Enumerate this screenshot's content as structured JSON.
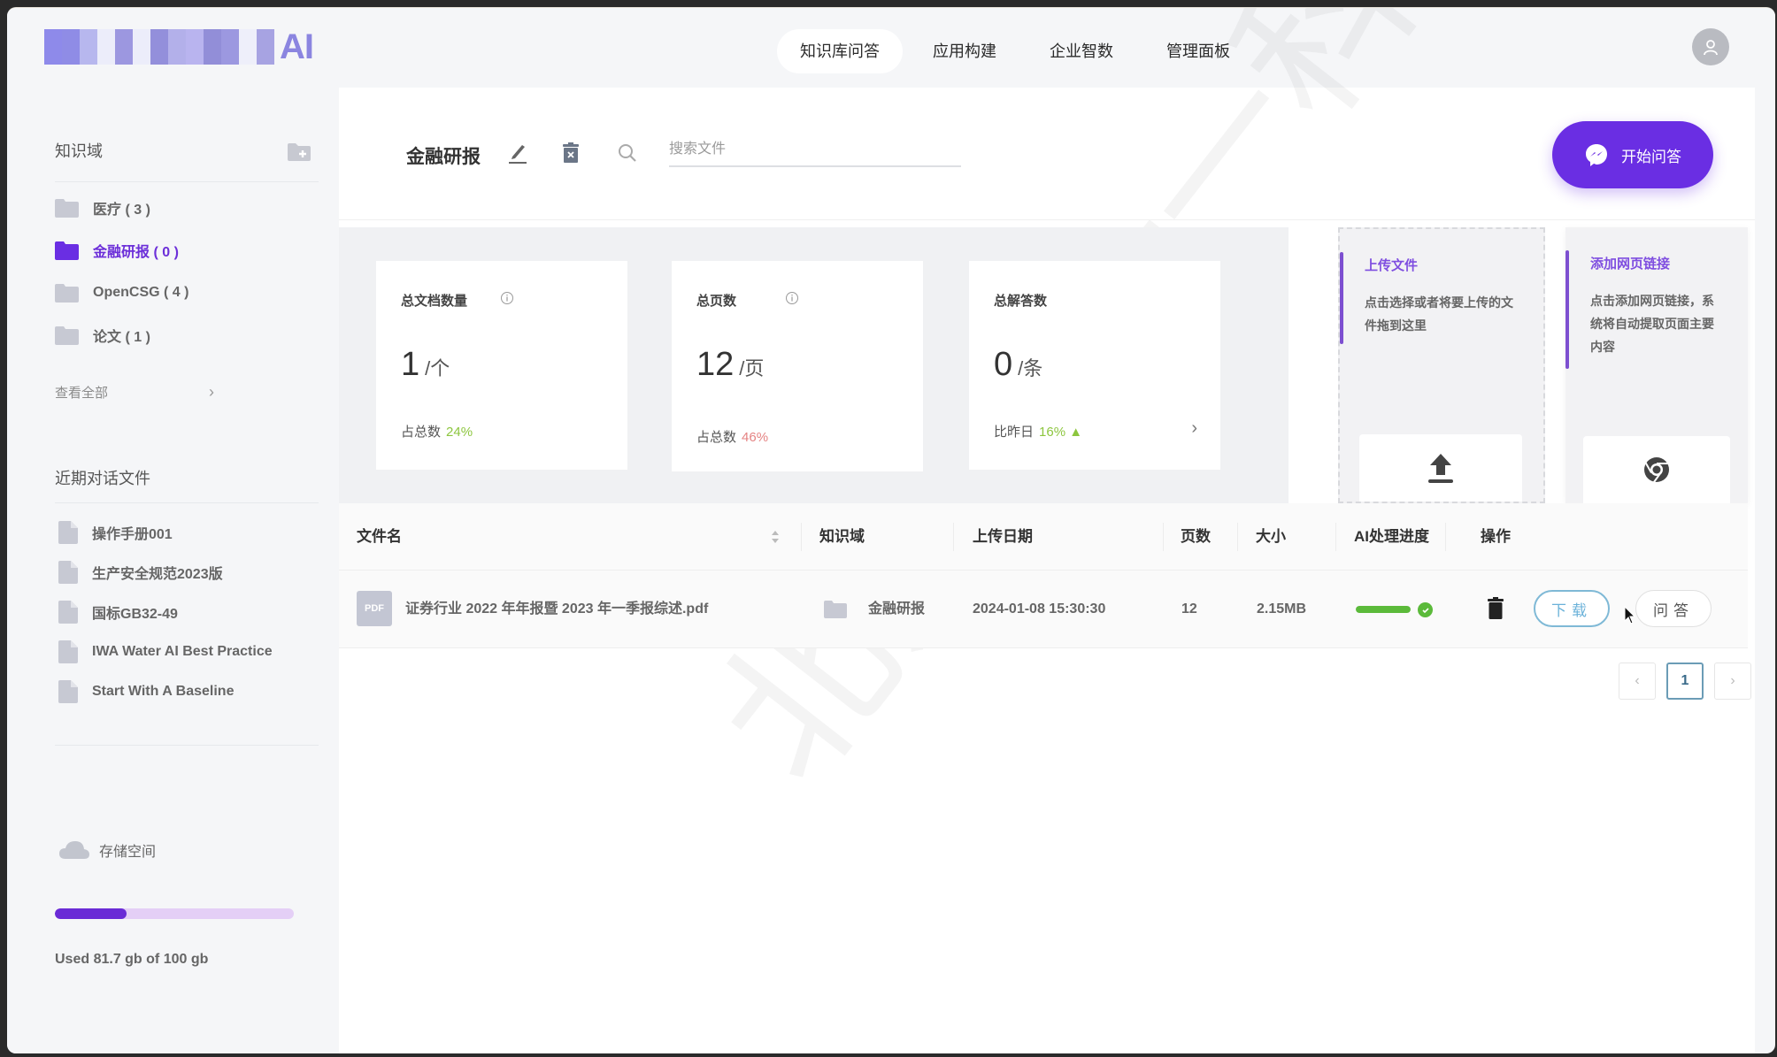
{
  "app": {
    "logo_suffix": "AI",
    "logo_colors": [
      "#8e8aea",
      "#8f8ce6",
      "#b7b7ee",
      "#ecedfa",
      "#9c97e0",
      "#ecedfa",
      "#938fdb",
      "#b3b0ea",
      "#b9b4ef",
      "#928ed8",
      "#9c98e0",
      "#eeeffa",
      "#a7a3e2"
    ]
  },
  "nav": {
    "items": [
      {
        "label": "知识库问答",
        "active": true
      },
      {
        "label": "应用构建",
        "active": false
      },
      {
        "label": "企业智数",
        "active": false
      },
      {
        "label": "管理面板",
        "active": false
      }
    ]
  },
  "sidebar": {
    "knowledge_title": "知识域",
    "folders": [
      {
        "label": "医疗 ( 3 )",
        "active": false
      },
      {
        "label": "金融研报 ( 0 )",
        "active": true
      },
      {
        "label": "OpenCSG ( 4 )",
        "active": false
      },
      {
        "label": "论文 ( 1 )",
        "active": false
      }
    ],
    "view_all": "查看全部",
    "recent_title": "近期对话文件",
    "recent_files": [
      "操作手册001",
      "生产安全规范2023版",
      "国标GB32-49",
      "IWA Water AI Best Practice",
      "Start With A Baseline"
    ],
    "storage": {
      "label": "存储空间",
      "used_fraction": 0.3,
      "text": "Used 81.7 gb of 100 gb"
    }
  },
  "main": {
    "kb_title": "金融研报",
    "search_placeholder": "搜索文件",
    "start_button": "开始问答",
    "stats": [
      {
        "title": "总文档数量",
        "value": "1",
        "unit": "/个",
        "foot_label": "占总数",
        "foot_value": "24%",
        "foot_color": "green",
        "has_info": true
      },
      {
        "title": "总页数",
        "value": "12",
        "unit": "/页",
        "foot_label": "占总数",
        "foot_value": "46%",
        "foot_color": "red",
        "has_info": true
      },
      {
        "title": "总解答数",
        "value": "0",
        "unit": "/条",
        "foot_label": "比昨日",
        "foot_value": "16% ▲",
        "foot_color": "green",
        "has_info": false
      }
    ],
    "upload_card": {
      "title": "上传文件",
      "desc": "点击选择或者将要上传的文件拖到这里"
    },
    "link_card": {
      "title": "添加网页链接",
      "desc": "点击添加网页链接，系统将自动提取页面主要内容"
    },
    "table": {
      "headers": [
        "文件名",
        "知识域",
        "上传日期",
        "页数",
        "大小",
        "AI处理进度",
        "操作"
      ],
      "rows": [
        {
          "file_type": "PDF",
          "name": "证券行业 2022 年年报暨 2023 年一季报综述.pdf",
          "domain": "金融研报",
          "date": "2024-01-08 15:30:30",
          "pages": "12",
          "size": "2.15MB",
          "progress": 1.0,
          "download_label": "下载",
          "qa_label": "问答"
        }
      ]
    },
    "pagination": {
      "current": "1",
      "prev": "‹",
      "next": "›"
    }
  },
  "watermark": "北京柒十一科技",
  "colors": {
    "accent": "#6a2ee3",
    "active_folder": "#6c2fd9",
    "success": "#5bba3a"
  }
}
